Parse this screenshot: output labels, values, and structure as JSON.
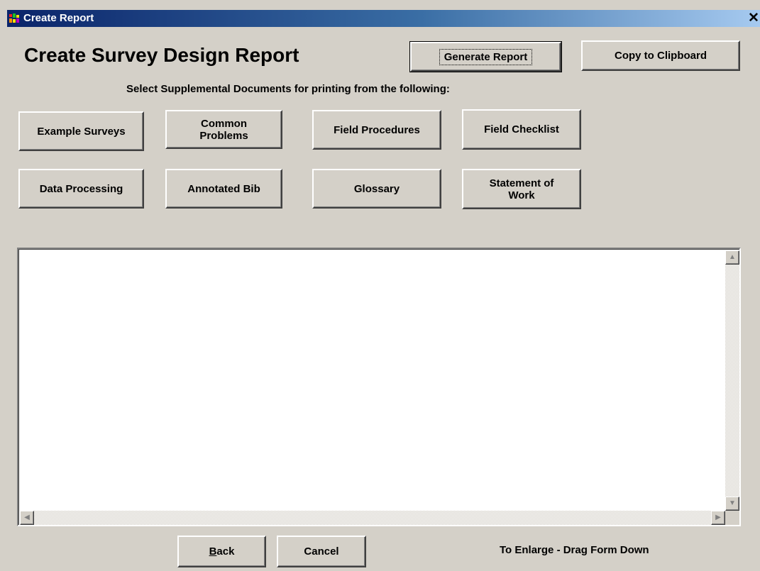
{
  "window": {
    "title": "Create Report",
    "close_glyph": "✕",
    "icon": "app-icon"
  },
  "header": {
    "heading": "Create Survey Design Report",
    "subtitle": "Select Supplemental Documents for printing from the following:"
  },
  "toolbar": {
    "generate_label": "Generate Report",
    "copy_label": "Copy to Clipboard"
  },
  "documents": {
    "row1": [
      "Example Surveys",
      "Common Problems",
      "Field Procedures",
      "Field Checklist"
    ],
    "row2": [
      "Data Processing",
      "Annotated Bib",
      "Glossary",
      "Statement of Work"
    ]
  },
  "report_text": {
    "value": ""
  },
  "footer": {
    "back_accel": "B",
    "back_rest": "ack",
    "cancel_label": "Cancel",
    "note": "To Enlarge - Drag Form Down"
  },
  "colors": {
    "titlebar_start": "#0a246a",
    "titlebar_end": "#a6caf0",
    "face": "#d4d0c8"
  }
}
